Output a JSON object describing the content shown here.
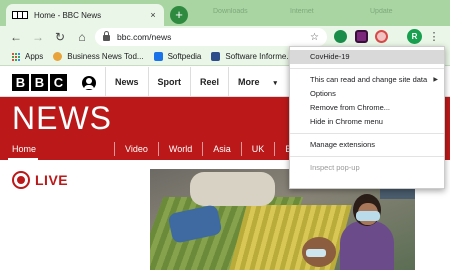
{
  "browser": {
    "tab_title": "Home - BBC News",
    "tab_close": "×",
    "new_tab": "+",
    "url": "bbc.com/news",
    "avatar_letter": "R",
    "faded_tabs": [
      "Downloads",
      "Internet",
      "Update"
    ]
  },
  "nav": {
    "back": "←",
    "forward": "→",
    "reload": "↻",
    "home": "⌂",
    "star": "☆",
    "menu": "⋮"
  },
  "bookmarks": [
    {
      "label": "Apps",
      "icon": "apps-grid-icon"
    },
    {
      "label": "Business News Tod...",
      "icon": "news-site-icon",
      "color": "#e8a33a"
    },
    {
      "label": "Softpedia",
      "icon": "softpedia-icon",
      "color": "#1a73e8"
    },
    {
      "label": "Software Informe...",
      "icon": "software-informer-icon",
      "color": "#2c4c8c"
    }
  ],
  "extensions": [
    {
      "name": "green-extension-icon",
      "color": "#1b8d4b"
    },
    {
      "name": "purple-extension-icon",
      "color": "#7b2a7b"
    },
    {
      "name": "covhide-extension-icon",
      "color": "#d84a4a"
    }
  ],
  "bbc": {
    "logo": [
      "B",
      "B",
      "C"
    ],
    "topnav": [
      "News",
      "Sport",
      "Reel",
      "More"
    ],
    "more_caret": "▾",
    "news_word": "NEWS",
    "sections": [
      "Home",
      "Video",
      "World",
      "Asia",
      "UK",
      "Busine"
    ],
    "live_label": "LIVE"
  },
  "context_menu": {
    "title": "CovHide-19",
    "items": [
      {
        "label": "This can read and change site data",
        "submenu": true
      },
      {
        "label": "Options"
      },
      {
        "label": "Remove from Chrome..."
      },
      {
        "label": "Hide in Chrome menu"
      }
    ],
    "manage": "Manage extensions",
    "inspect": "Inspect pop-up",
    "submenu_arrow": "▶"
  },
  "colors": {
    "bbc_red": "#bb1919",
    "chrome_frame": "#a8d5a2",
    "chrome_toolbar": "#eaf6e7",
    "profile_green": "#18a050"
  }
}
